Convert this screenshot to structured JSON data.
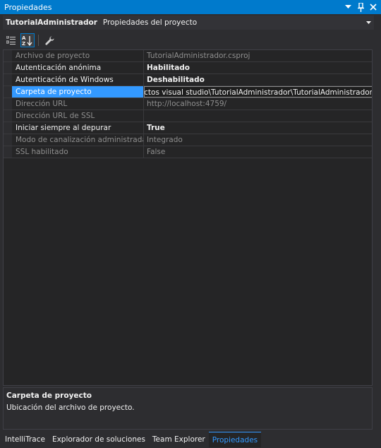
{
  "window": {
    "title": "Propiedades",
    "buttons": [
      "pin-dropdown",
      "pin",
      "close"
    ]
  },
  "object_selector": {
    "name": "TutorialAdministrador",
    "type": "Propiedades del proyecto"
  },
  "toolbar": {
    "buttons": [
      "categorized-icon",
      "alphabetical-icon",
      "property-pages-icon"
    ],
    "active": "alphabetical-icon"
  },
  "properties": [
    {
      "name": "Archivo de proyecto",
      "value": "TutorialAdministrador.csproj",
      "dim": true,
      "bold": false
    },
    {
      "name": "Autenticación anónima",
      "value": "Habilitado",
      "dim": false,
      "bold": true
    },
    {
      "name": "Autenticación de Windows",
      "value": "Deshabilitado",
      "dim": false,
      "bold": true
    },
    {
      "name": "Carpeta de proyecto",
      "value": "royectos visual studio\\TutorialAdministrador\\TutorialAdministrador\\",
      "dim": false,
      "bold": false,
      "selected": true
    },
    {
      "name": "Dirección URL",
      "value": "http://localhost:4759/",
      "dim": true,
      "bold": false
    },
    {
      "name": "Dirección URL de SSL",
      "value": "",
      "dim": true,
      "bold": false
    },
    {
      "name": "Iniciar siempre al depurar",
      "value": "True",
      "dim": false,
      "bold": true
    },
    {
      "name": "Modo de canalización administrada",
      "value": "Integrado",
      "dim": true,
      "bold": false
    },
    {
      "name": "SSL habilitado",
      "value": "False",
      "dim": true,
      "bold": false
    }
  ],
  "description": {
    "title": "Carpeta de proyecto",
    "text": "Ubicación del archivo de proyecto."
  },
  "tabs": [
    {
      "label": "IntelliTrace",
      "active": false
    },
    {
      "label": "Explorador de soluciones",
      "active": false
    },
    {
      "label": "Team Explorer",
      "active": false
    },
    {
      "label": "Propiedades",
      "active": true
    }
  ],
  "colors": {
    "accent": "#007acc",
    "selection": "#3399ff",
    "background": "#2d2d30"
  }
}
